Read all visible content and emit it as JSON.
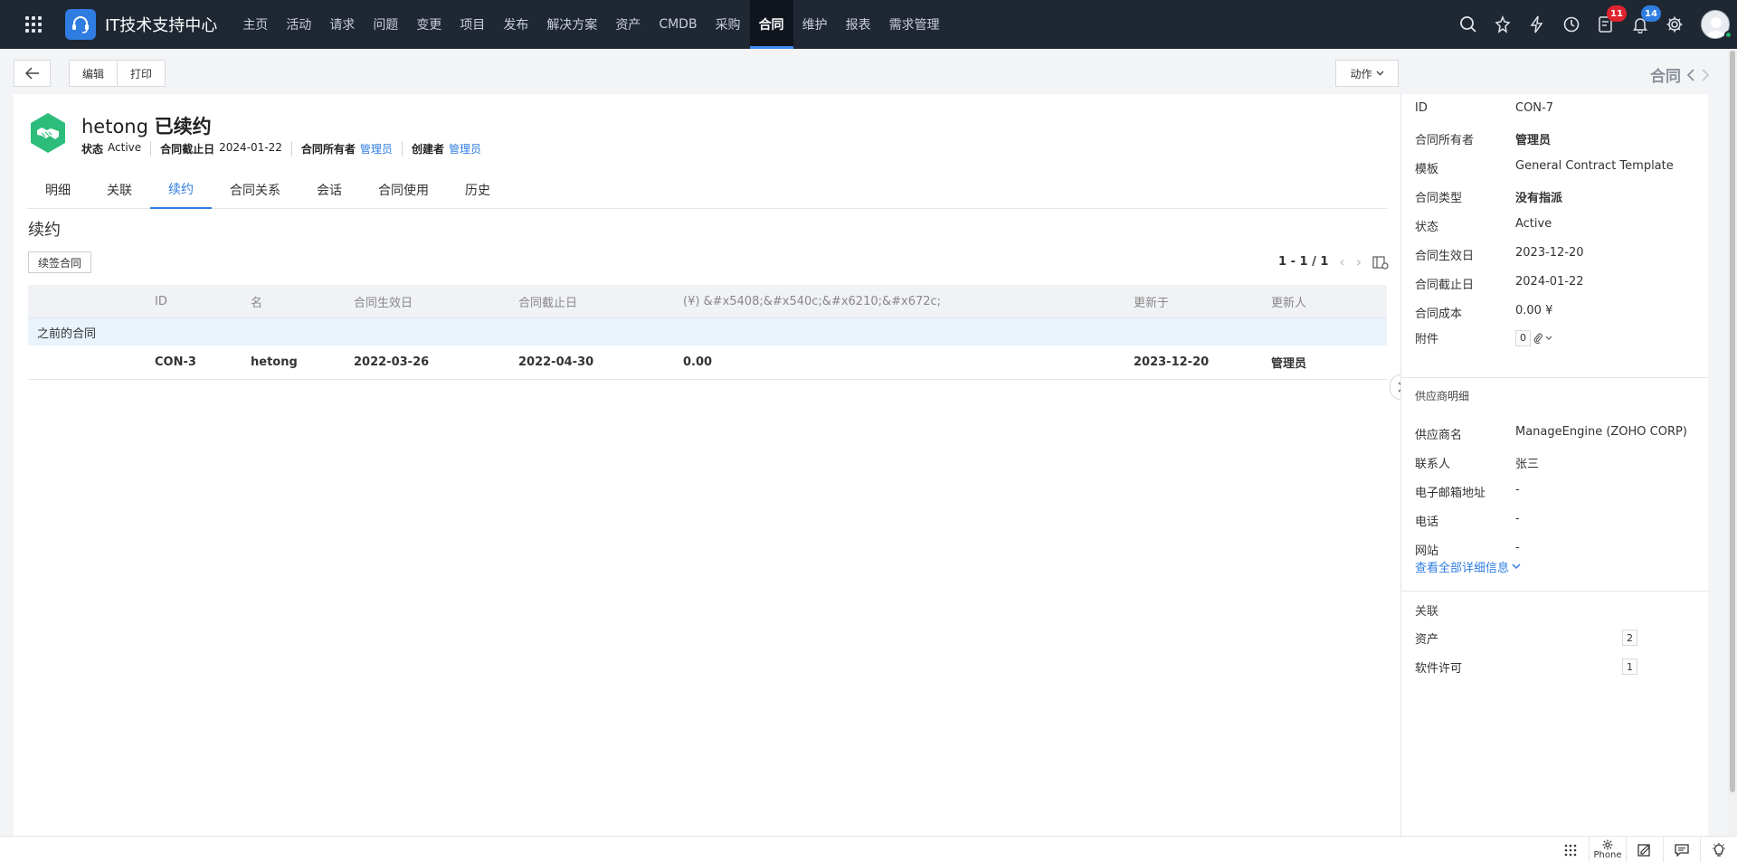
{
  "topnav": {
    "brand": "IT技术支持中心",
    "items": [
      "主页",
      "活动",
      "请求",
      "问题",
      "变更",
      "项目",
      "发布",
      "解决方案",
      "资产",
      "CMDB",
      "采购",
      "合同",
      "维护",
      "报表",
      "需求管理"
    ],
    "active_index": 11,
    "badges": {
      "tasks": "11",
      "notifications": "14"
    },
    "colors": {
      "bar": "#1f2733",
      "accent": "#2f7de1"
    }
  },
  "toolbar": {
    "edit_label": "编辑",
    "print_label": "打印",
    "action_label": "动作",
    "module_label": "合同"
  },
  "header": {
    "name": "hetong",
    "status_suffix": "已续约",
    "meta": {
      "status_key": "状态",
      "status_val": "Active",
      "end_key": "合同截止日",
      "end_val": "2024-01-22",
      "owner_key": "合同所有者",
      "owner_val": "管理员",
      "creator_key": "创建者",
      "creator_val": "管理员"
    }
  },
  "tabs": [
    "明细",
    "关联",
    "续约",
    "合同关系",
    "会话",
    "合同使用",
    "历史"
  ],
  "tab_active_index": 2,
  "renewal": {
    "title": "续约",
    "renew_button": "续签合同",
    "pager": "1 - 1 / 1",
    "columns": [
      "",
      "ID",
      "名",
      "合同生效日",
      "合同截止日",
      "(¥) &#x5408;&#x540c;&#x6210;&#x672c;",
      "更新于",
      "更新人"
    ],
    "group_label": "之前的合同",
    "rows": [
      [
        "",
        "CON-3",
        "hetong",
        "2022-03-26",
        "2022-04-30",
        "0.00",
        "2023-12-20",
        "管理员"
      ]
    ]
  },
  "side": {
    "fields": [
      {
        "k": "ID",
        "v": "CON-7",
        "bold": false
      },
      {
        "k": "合同所有者",
        "v": "管理员",
        "bold": true
      },
      {
        "k": "模板",
        "v": "General Contract Template",
        "bold": false
      },
      {
        "k": "合同类型",
        "v": "没有指派",
        "bold": true
      },
      {
        "k": "状态",
        "v": "Active",
        "bold": false
      },
      {
        "k": "合同生效日",
        "v": "2023-12-20",
        "bold": false
      },
      {
        "k": "合同截止日",
        "v": "2024-01-22",
        "bold": false
      },
      {
        "k": "合同成本",
        "v": "0.00 ¥",
        "bold": false
      }
    ],
    "attachment_key": "附件",
    "attachment_count": "0",
    "vendor_title": "供应商明细",
    "vendor_fields": [
      {
        "k": "供应商名",
        "v": "ManageEngine (ZOHO CORP)"
      },
      {
        "k": "联系人",
        "v": "张三"
      },
      {
        "k": "电子邮箱地址",
        "v": "-"
      },
      {
        "k": "电话",
        "v": "-"
      },
      {
        "k": "网站",
        "v": "-"
      }
    ],
    "view_all": "查看全部详细信息",
    "assoc_title": "关联",
    "assoc": [
      {
        "k": "资产",
        "v": "2"
      },
      {
        "k": "软件许可",
        "v": "1"
      }
    ]
  },
  "bottombar": {
    "phone_label": "Phone"
  }
}
